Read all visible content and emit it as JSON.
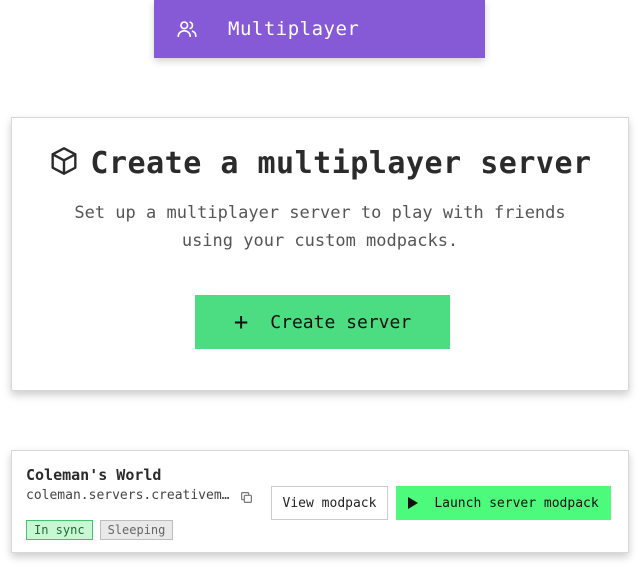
{
  "tab": {
    "label": "Multiplayer",
    "icon": "users-icon",
    "color": "#8659d6"
  },
  "create_card": {
    "icon": "cube-icon",
    "title": "Create a multiplayer server",
    "description": "Set up a multiplayer server to play with friends using your custom modpacks.",
    "button_icon": "plus-icon",
    "button_label": "Create server",
    "button_color": "#4cdc82"
  },
  "server": {
    "name": "Coleman's World",
    "address": "coleman.servers.creativem…",
    "copy_icon": "copy-icon",
    "badges": {
      "sync": "In sync",
      "state": "Sleeping"
    },
    "view_button_label": "View modpack",
    "launch_button_icon": "play-icon",
    "launch_button_label": "Launch server modpack",
    "launch_button_color": "#4cfa7c"
  }
}
